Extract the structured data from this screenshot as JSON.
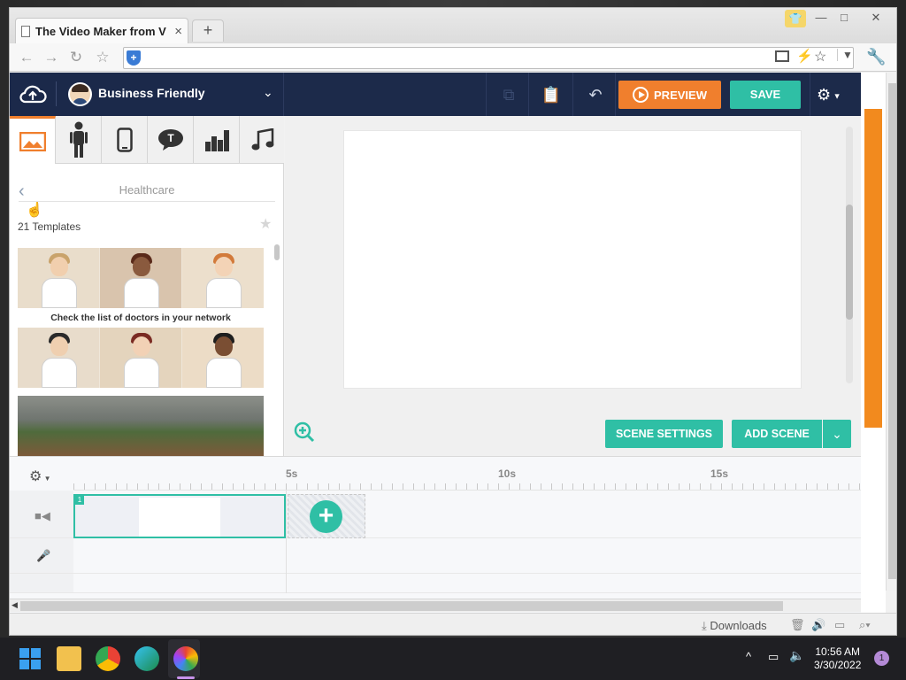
{
  "browser": {
    "tab_title": "The Video Maker from V",
    "tab_close": "×",
    "new_tab": "+",
    "window_controls": [
      "—",
      "□",
      "✕"
    ]
  },
  "app": {
    "workspace_name": "Business Friendly",
    "preview_label": "PREVIEW",
    "save_label": "SAVE",
    "category_tabs": [
      "image-icon",
      "character-icon",
      "device-icon",
      "text-bubble-icon",
      "chart-icon",
      "music-icon"
    ],
    "panel": {
      "title": "Healthcare",
      "template_count": "21 Templates",
      "template1_caption": "Check the list of doctors in your network"
    },
    "stage": {
      "scene_settings_label": "SCENE SETTINGS",
      "add_scene_label": "ADD SCENE"
    },
    "timeline": {
      "ticks": [
        "5s",
        "10s",
        "15s"
      ],
      "scene_number": "1"
    }
  },
  "statusbar": {
    "downloads_label": "Downloads"
  },
  "taskbar": {
    "time": "10:56 AM",
    "date": "3/30/2022",
    "notification_count": "1"
  },
  "colors": {
    "accent_orange": "#f07f2d",
    "accent_teal": "#2fbfa5",
    "appbar_navy": "#1c2a4a"
  }
}
